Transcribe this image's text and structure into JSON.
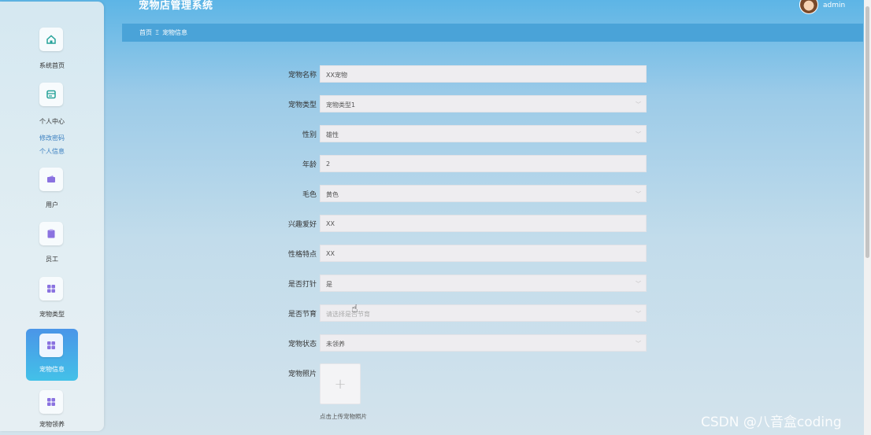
{
  "header": {
    "app_title": "宠物店管理系统",
    "username": "admin"
  },
  "breadcrumb": {
    "home": "首页",
    "separator": "Ξ",
    "current": "宠物信息"
  },
  "sidebar": {
    "items": [
      {
        "label": "系统首页",
        "icon": "home-icon"
      },
      {
        "label": "个人中心",
        "icon": "id-card-icon",
        "subitems": [
          "修改密码",
          "个人信息"
        ]
      },
      {
        "label": "用户",
        "icon": "wallet-icon"
      },
      {
        "label": "员工",
        "icon": "clipboard-icon"
      },
      {
        "label": "宠物类型",
        "icon": "grid-icon"
      },
      {
        "label": "宠物信息",
        "icon": "grid-icon",
        "active": true
      },
      {
        "label": "宠物领养",
        "icon": "grid-icon"
      }
    ]
  },
  "form": {
    "fields": [
      {
        "label": "宠物名称",
        "value": "XX宠物",
        "type": "text"
      },
      {
        "label": "宠物类型",
        "value": "宠物类型1",
        "type": "select"
      },
      {
        "label": "性别",
        "value": "雄性",
        "type": "select"
      },
      {
        "label": "年龄",
        "value": "2",
        "type": "text"
      },
      {
        "label": "毛色",
        "value": "黄色",
        "type": "select"
      },
      {
        "label": "兴趣爱好",
        "value": "XX",
        "type": "text"
      },
      {
        "label": "性格特点",
        "value": "XX",
        "type": "text"
      },
      {
        "label": "是否打针",
        "value": "是",
        "type": "select"
      },
      {
        "label": "是否节育",
        "value": "请选择是否节育",
        "type": "select",
        "placeholder": true
      },
      {
        "label": "宠物状态",
        "value": "未领养",
        "type": "select"
      }
    ],
    "photo": {
      "label": "宠物照片",
      "hint": "点击上传宠物照片"
    }
  },
  "watermark": "CSDN @八音盒coding",
  "colors": {
    "active_nav": "#4a95e8",
    "breadcrumb_bg": "#4aa3d8",
    "field_bg": "#eeedf0"
  }
}
